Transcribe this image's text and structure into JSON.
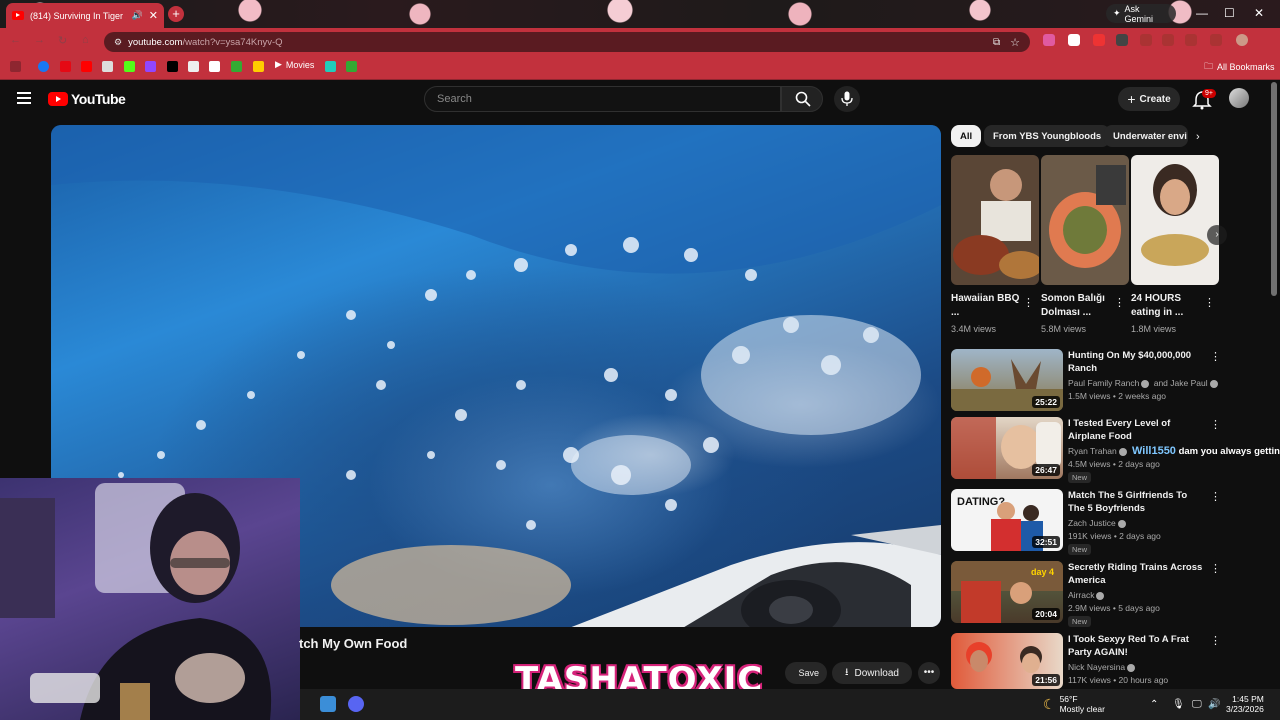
{
  "browser": {
    "tab_title": "(814) Surviving In Tiger Sha",
    "tab_close": "✕",
    "new_tab": "+",
    "ask_gemini": "Ask Gemini",
    "url_host": "youtube.com",
    "url_path": "/watch?v=ysa74Knyv-Q",
    "minimize": "—",
    "maximize": "☐",
    "close": "✕",
    "bookmarks": {
      "movies": "Movies",
      "all": "All Bookmarks"
    },
    "theme_color": "#c2313d"
  },
  "youtube": {
    "logo": "YouTube",
    "search_placeholder": "Search",
    "create": "Create",
    "notif_count": "9+"
  },
  "player": {
    "title_partial": "tch My Own Food",
    "save": "Save",
    "download": "Download",
    "more": "•••",
    "watermark": "TASHATOXIC"
  },
  "chips": [
    "All",
    "From YBS Youngbloods",
    "Underwater envi"
  ],
  "shorts": [
    {
      "title": "Hawaiian BBQ ...",
      "views": "3.4M views",
      "color": "#7a5a3a"
    },
    {
      "title": "Somon Balığı Dolması ...",
      "views": "5.8M views",
      "color": "#b35a3a"
    },
    {
      "title": "24 HOURS eating in ...",
      "views": "1.8M views",
      "color": "#d8cfc4"
    }
  ],
  "recommendations": [
    {
      "title": "Hunting On My $40,000,000 Ranch",
      "channel": "Paul Family Ranch",
      "channel2": "and Jake Paul",
      "meta": "1.5M views • 2 weeks ago",
      "duration": "25:22",
      "new": "",
      "color": "#6e8aa0"
    },
    {
      "title": "I Tested Every Level of Airplane Food",
      "channel": "Ryan Trahan",
      "channel2": "",
      "meta": "4.5M views • 2 days ago",
      "duration": "26:47",
      "new": "New",
      "color": "#c98b70"
    },
    {
      "title": "Match The 5 Girlfriends To The 5 Boyfriends",
      "channel": "Zach Justice",
      "channel2": "",
      "meta": "191K views • 2 days ago",
      "duration": "32:51",
      "new": "New",
      "color": "#e8e8e8"
    },
    {
      "title": "Secretly Riding Trains Across America",
      "channel": "Airrack",
      "channel2": "",
      "meta": "2.9M views • 5 days ago",
      "duration": "20:04",
      "new": "New",
      "color": "#6a4a3a"
    },
    {
      "title": "I Took Sexyy Red To A Frat Party AGAIN!",
      "channel": "Nick Nayersina",
      "channel2": "",
      "meta": "117K views • 20 hours ago",
      "duration": "21:56",
      "new": "",
      "color": "#c45a4a"
    }
  ],
  "chat": {
    "user": "Will1550",
    "message": "dam you always getting"
  },
  "taskbar": {
    "temp": "56°F",
    "weather": "Mostly clear",
    "time": "1:45 PM",
    "date": "3/23/2026"
  }
}
